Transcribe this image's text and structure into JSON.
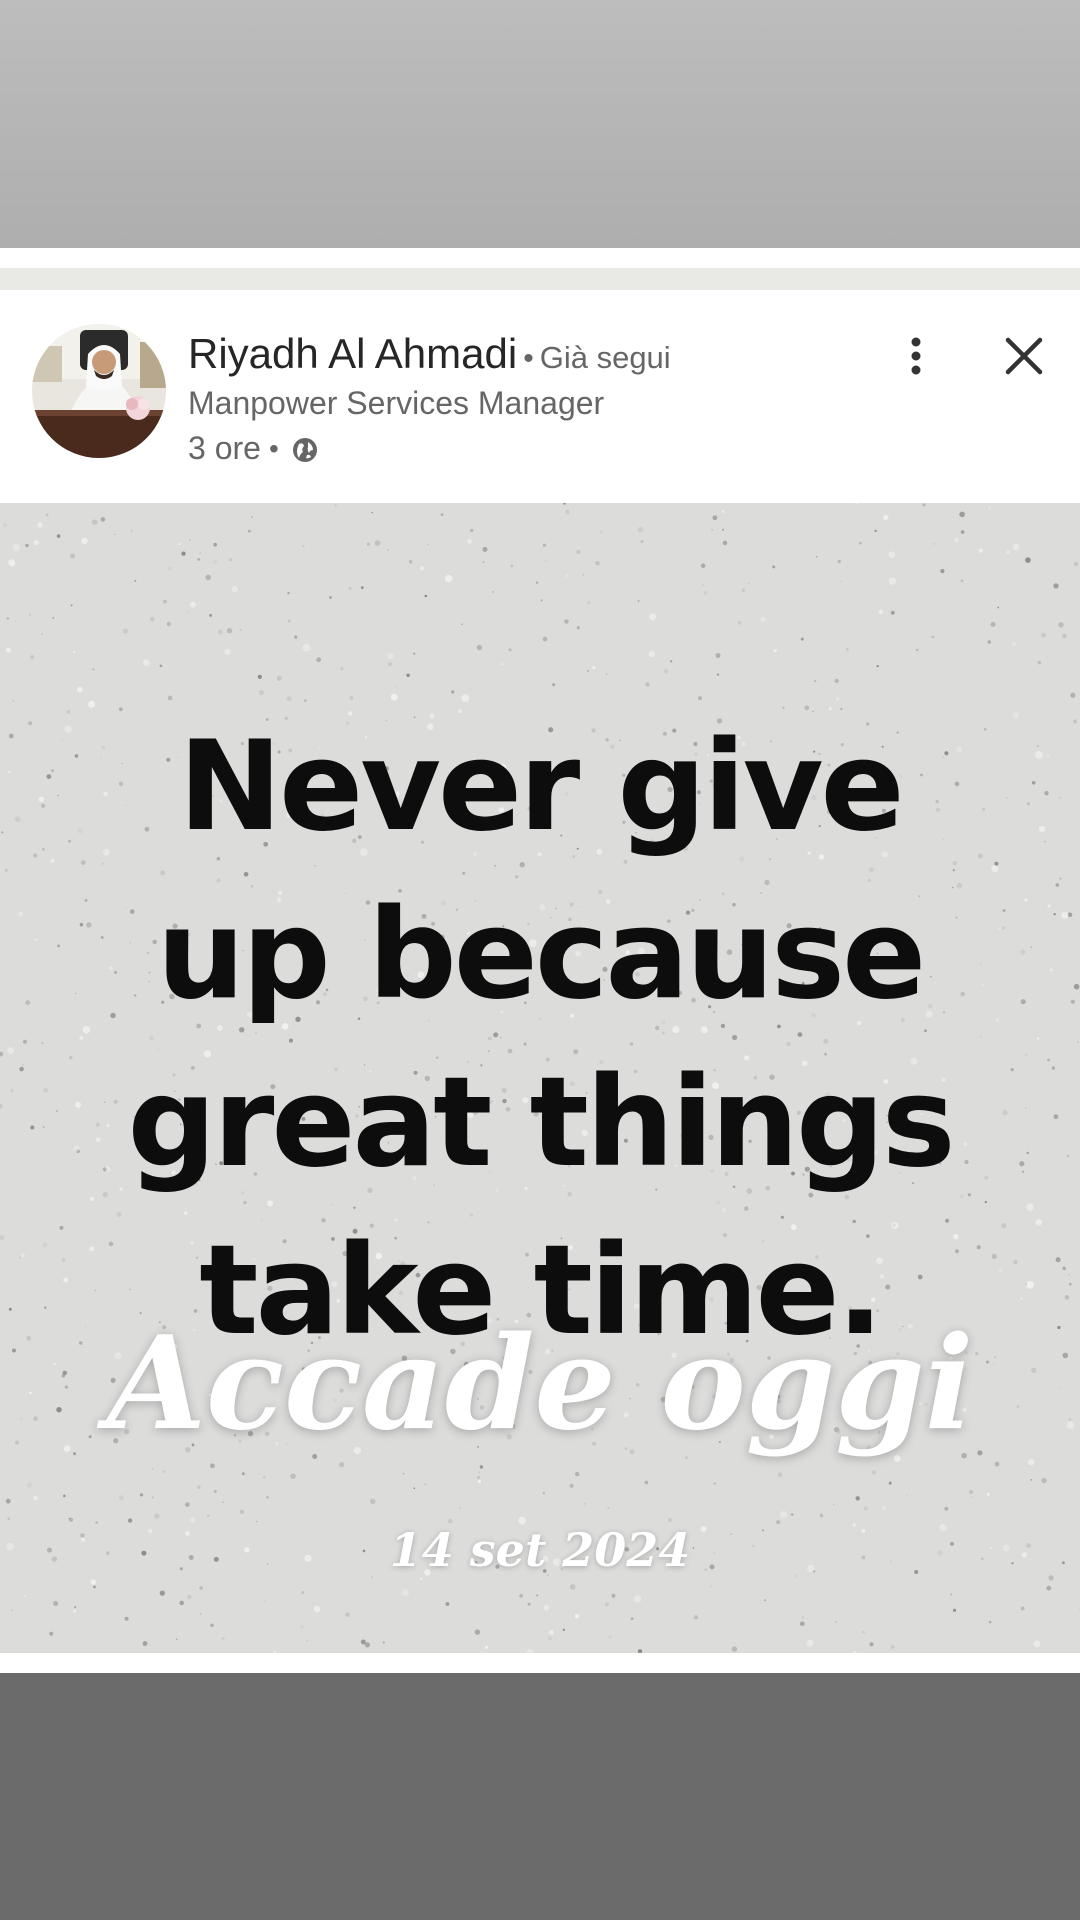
{
  "post": {
    "author": {
      "name": "Riyadh Al Ahmadi",
      "follow_status": "Già segui",
      "title": "Manpower Services Manager",
      "avatar_icon": "person-avatar"
    },
    "meta": {
      "time": "3 ore",
      "visibility_icon": "globe-icon"
    },
    "actions": {
      "more_icon": "more-vertical-icon",
      "close_icon": "close-icon"
    },
    "image": {
      "quote_lines": [
        "Never give",
        "up because",
        "great things",
        "take time."
      ],
      "overlay_title": "Accade oggi",
      "overlay_date": "14 set 2024"
    }
  },
  "colors": {
    "top_backdrop": "#b4b4b4",
    "bottom_backdrop": "#6b6b6b",
    "card_background": "#ffffff",
    "image_background": "#dcdcdb",
    "quote_text": "#0d0d0d",
    "overlay_text": "#ffffff"
  }
}
